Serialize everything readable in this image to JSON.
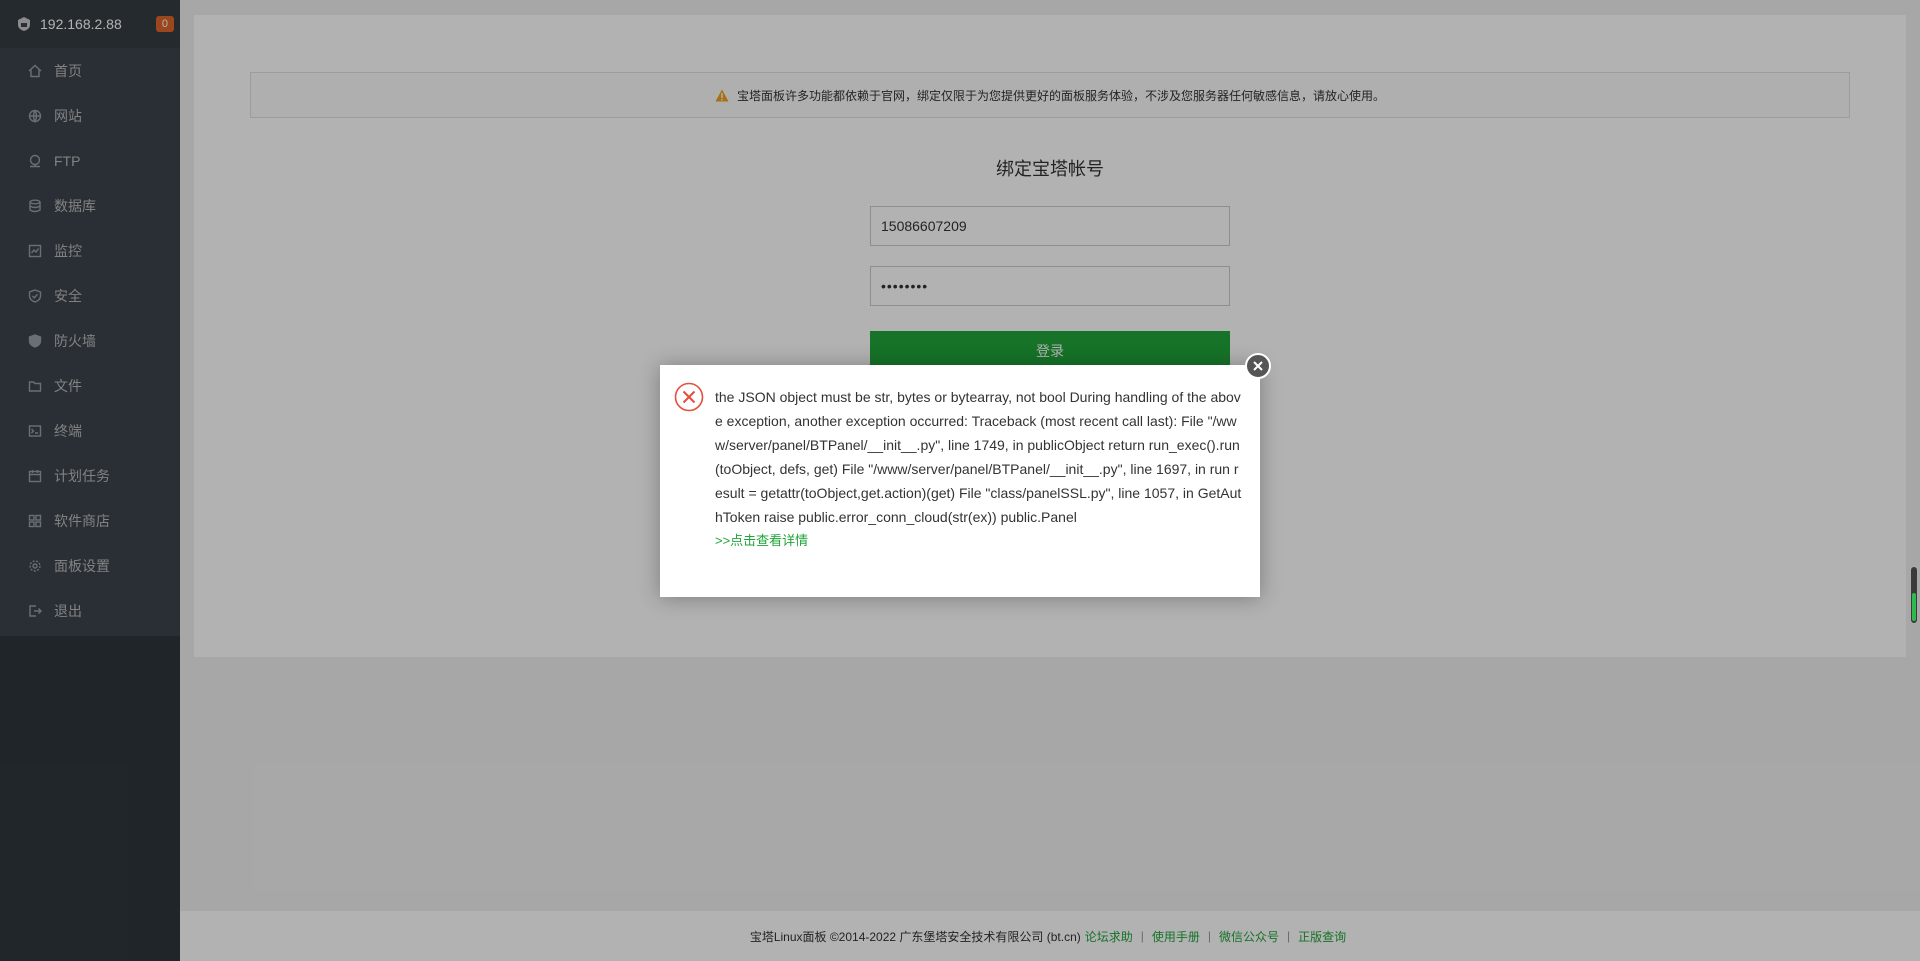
{
  "sidebar": {
    "ip": "192.168.2.88",
    "badge": "0",
    "items": [
      {
        "label": "首页",
        "icon": "home-icon"
      },
      {
        "label": "网站",
        "icon": "globe-icon"
      },
      {
        "label": "FTP",
        "icon": "ftp-icon"
      },
      {
        "label": "数据库",
        "icon": "database-icon"
      },
      {
        "label": "监控",
        "icon": "monitor-icon"
      },
      {
        "label": "安全",
        "icon": "shield-icon"
      },
      {
        "label": "防火墙",
        "icon": "firewall-icon"
      },
      {
        "label": "文件",
        "icon": "folder-icon"
      },
      {
        "label": "终端",
        "icon": "terminal-icon"
      },
      {
        "label": "计划任务",
        "icon": "calendar-icon"
      },
      {
        "label": "软件商店",
        "icon": "apps-icon"
      },
      {
        "label": "面板设置",
        "icon": "gear-icon"
      },
      {
        "label": "退出",
        "icon": "logout-icon"
      }
    ]
  },
  "main": {
    "notice": "宝塔面板许多功能都依赖于官网，绑定仅限于为您提供更好的面板服务体验，不涉及您服务器任何敏感信息，请放心使用。",
    "title": "绑定宝塔帐号",
    "phone_value": "15086607209",
    "password_value": "••••••••",
    "login_label": "登录"
  },
  "dialog": {
    "message": "the JSON object must be str, bytes or bytearray, not bool During handling of the above exception, another exception occurred: Traceback (most recent call last): File \"/www/server/panel/BTPanel/__init__.py\", line 1749, in publicObject return run_exec().run(toObject, defs, get) File \"/www/server/panel/BTPanel/__init__.py\", line 1697, in run result = getattr(toObject,get.action)(get) File \"class/panelSSL.py\", line 1057, in GetAuthToken raise public.error_conn_cloud(str(ex)) public.Panel",
    "detail_link": ">>点击查看详情"
  },
  "footer": {
    "copyright": "宝塔Linux面板 ©2014-2022 广东堡塔安全技术有限公司 (bt.cn)",
    "links": [
      "论坛求助",
      "使用手册",
      "微信公众号",
      "正版查询"
    ],
    "separator": "|"
  },
  "colors": {
    "accent": "#20a53a",
    "sidebar_bg": "#3c444d",
    "badge": "#e0652a",
    "error": "#e74c3c"
  }
}
